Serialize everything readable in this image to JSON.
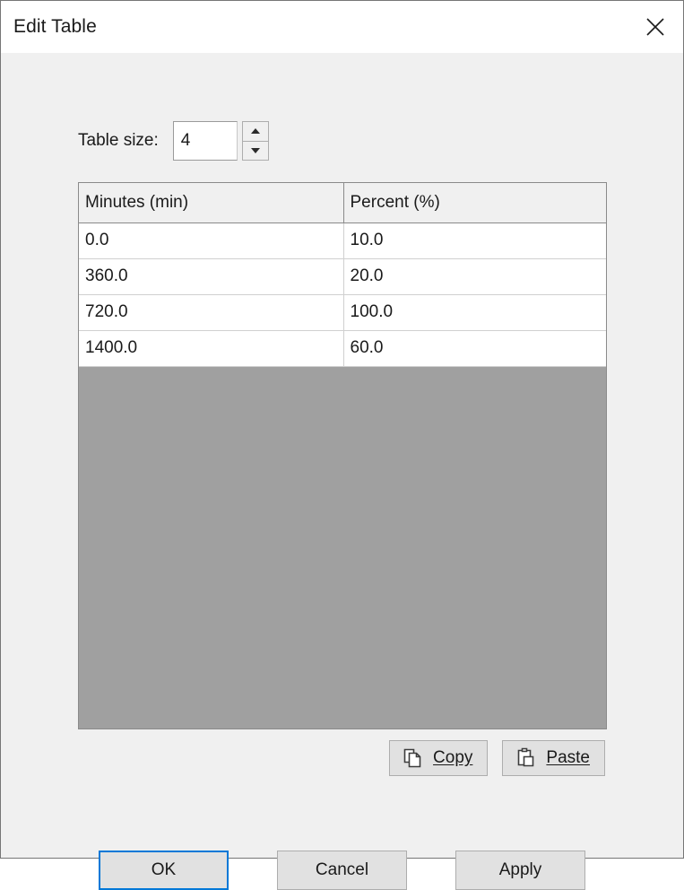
{
  "window": {
    "title": "Edit Table",
    "close_icon": "close-icon"
  },
  "form": {
    "table_size_label": "Table size:",
    "table_size_value": "4",
    "spinner_up_icon": "chevron-up-icon",
    "spinner_down_icon": "chevron-down-icon"
  },
  "table": {
    "columns": [
      "Minutes (min)",
      "Percent (%)"
    ],
    "rows": [
      [
        "0.0",
        "10.0"
      ],
      [
        "360.0",
        "20.0"
      ],
      [
        "720.0",
        "100.0"
      ],
      [
        "1400.0",
        "60.0"
      ]
    ],
    "empty_area_color": "#a0a0a0"
  },
  "clipboard": {
    "copy_label": "Copy",
    "copy_accel": "C",
    "copy_icon": "copy-icon",
    "paste_label": "Paste",
    "paste_accel": "P",
    "paste_icon": "paste-icon"
  },
  "buttons": {
    "ok": "OK",
    "cancel": "Cancel",
    "apply": "Apply",
    "focus_color": "#0078d7"
  }
}
